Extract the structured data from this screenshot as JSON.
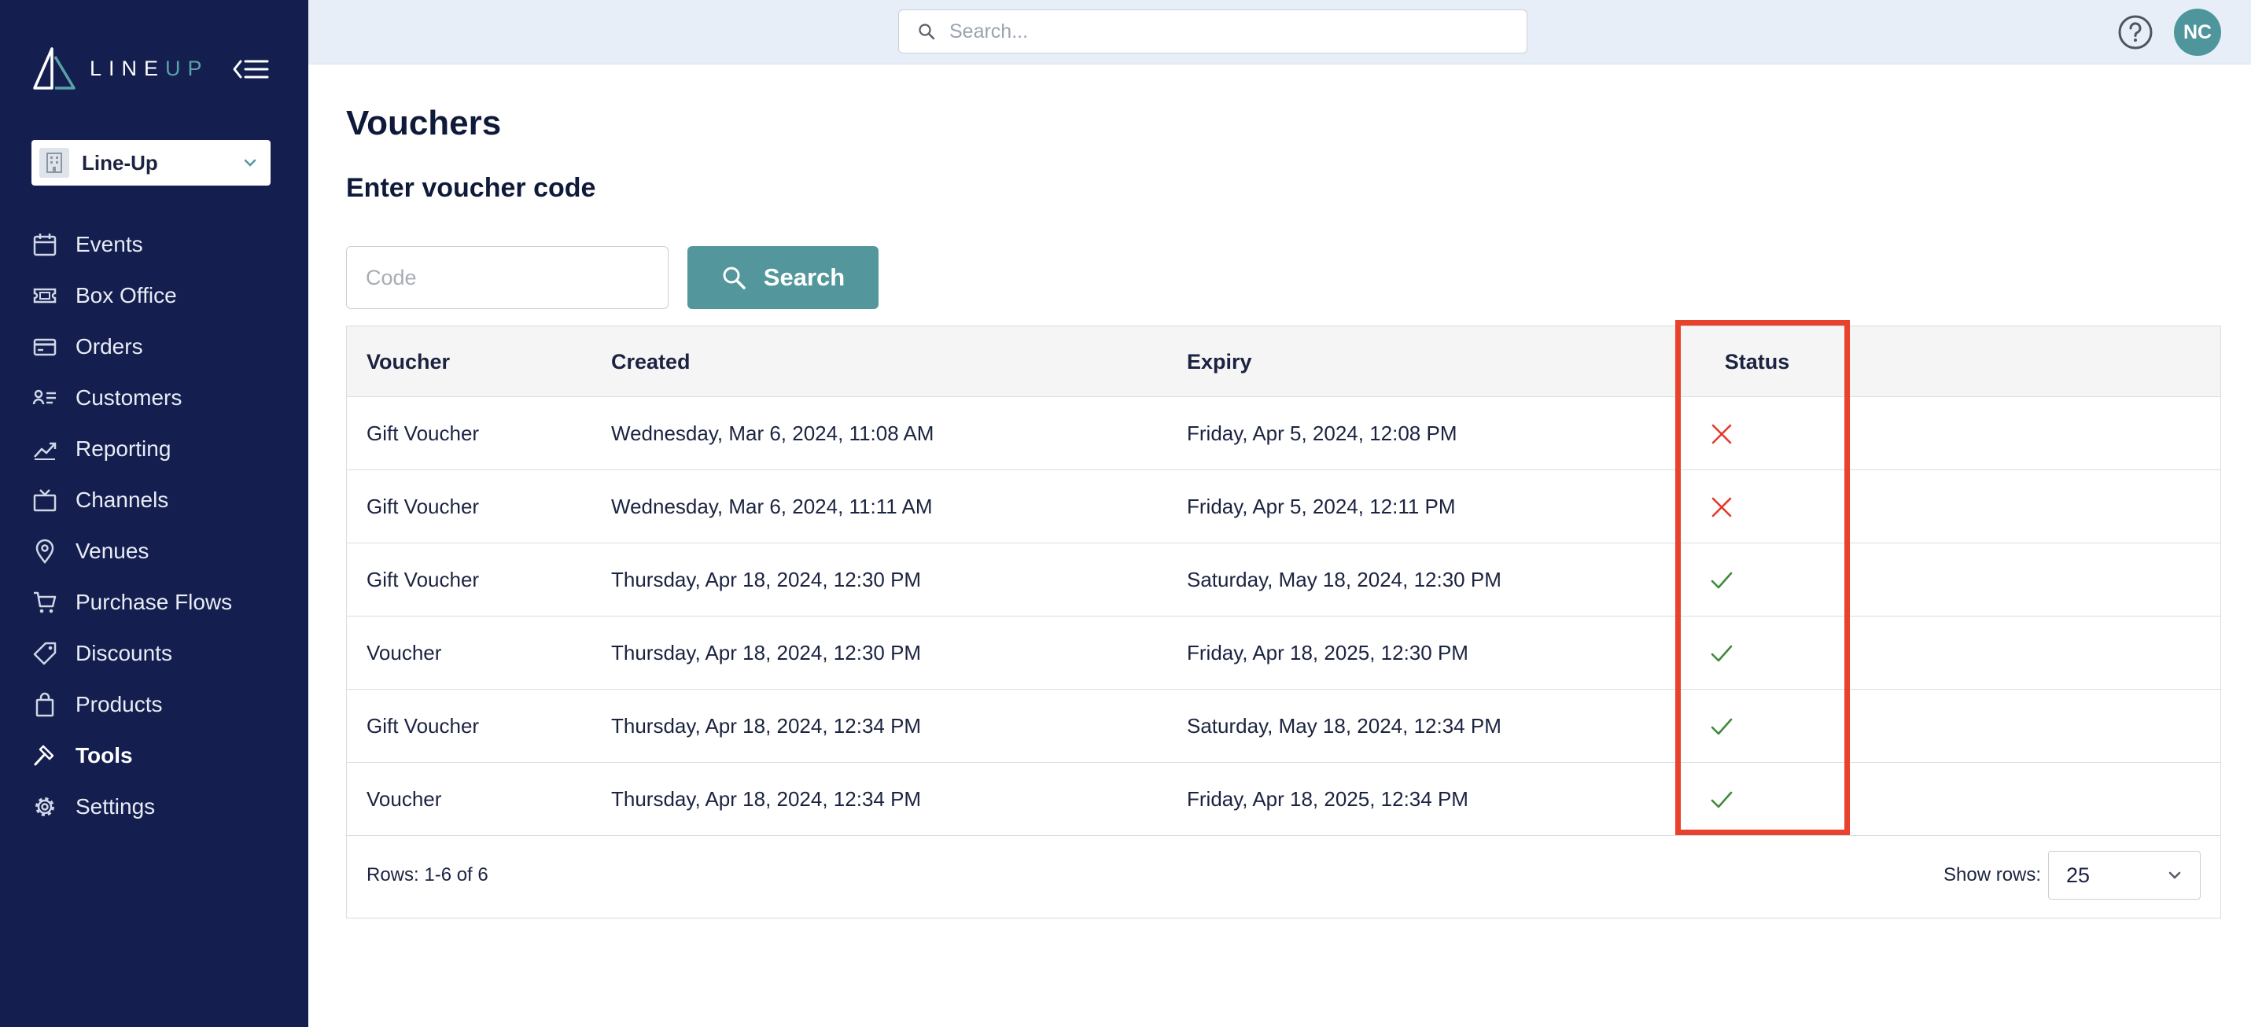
{
  "brand": {
    "logo_text_line": "LINE",
    "logo_text_up": "UP"
  },
  "org_selector": {
    "label": "Line-Up"
  },
  "sidebar": {
    "items": [
      {
        "label": "Events",
        "icon": "calendar-icon"
      },
      {
        "label": "Box Office",
        "icon": "ticket-icon"
      },
      {
        "label": "Orders",
        "icon": "credit-card-icon"
      },
      {
        "label": "Customers",
        "icon": "contact-card-icon"
      },
      {
        "label": "Reporting",
        "icon": "trend-chart-icon"
      },
      {
        "label": "Channels",
        "icon": "tv-icon"
      },
      {
        "label": "Venues",
        "icon": "location-pin-icon"
      },
      {
        "label": "Purchase Flows",
        "icon": "cart-icon"
      },
      {
        "label": "Discounts",
        "icon": "tag-icon"
      },
      {
        "label": "Products",
        "icon": "shopping-bag-icon"
      },
      {
        "label": "Tools",
        "icon": "hammer-icon",
        "active": true
      },
      {
        "label": "Settings",
        "icon": "gear-icon"
      }
    ]
  },
  "topbar": {
    "search_placeholder": "Search...",
    "avatar_initials": "NC"
  },
  "main": {
    "title": "Vouchers",
    "section_title": "Enter voucher code",
    "code_placeholder": "Code",
    "search_button": "Search"
  },
  "table": {
    "headers": {
      "voucher": "Voucher",
      "created": "Created",
      "expiry": "Expiry",
      "status": "Status"
    },
    "rows": [
      {
        "voucher": "Gift Voucher",
        "created": "Wednesday, Mar 6, 2024, 11:08 AM",
        "expiry": "Friday, Apr 5, 2024, 12:08 PM",
        "status": "invalid"
      },
      {
        "voucher": "Gift Voucher",
        "created": "Wednesday, Mar 6, 2024, 11:11 AM",
        "expiry": "Friday, Apr 5, 2024, 12:11 PM",
        "status": "invalid"
      },
      {
        "voucher": "Gift Voucher",
        "created": "Thursday, Apr 18, 2024, 12:30 PM",
        "expiry": "Saturday, May 18, 2024, 12:30 PM",
        "status": "valid"
      },
      {
        "voucher": "Voucher",
        "created": "Thursday, Apr 18, 2024, 12:30 PM",
        "expiry": "Friday, Apr 18, 2025, 12:30 PM",
        "status": "valid"
      },
      {
        "voucher": "Gift Voucher",
        "created": "Thursday, Apr 18, 2024, 12:34 PM",
        "expiry": "Saturday, May 18, 2024, 12:34 PM",
        "status": "valid"
      },
      {
        "voucher": "Voucher",
        "created": "Thursday, Apr 18, 2024, 12:34 PM",
        "expiry": "Friday, Apr 18, 2025, 12:34 PM",
        "status": "valid"
      }
    ],
    "footer": {
      "rows_info": "Rows: 1-6 of 6",
      "show_rows_label": "Show rows:",
      "show_rows_value": "25"
    }
  },
  "colors": {
    "sidebar_bg": "#141f4f",
    "accent": "#53979c",
    "invalid": "#e23a2a",
    "valid": "#3f8a3a",
    "highlight": "#e8412c"
  }
}
